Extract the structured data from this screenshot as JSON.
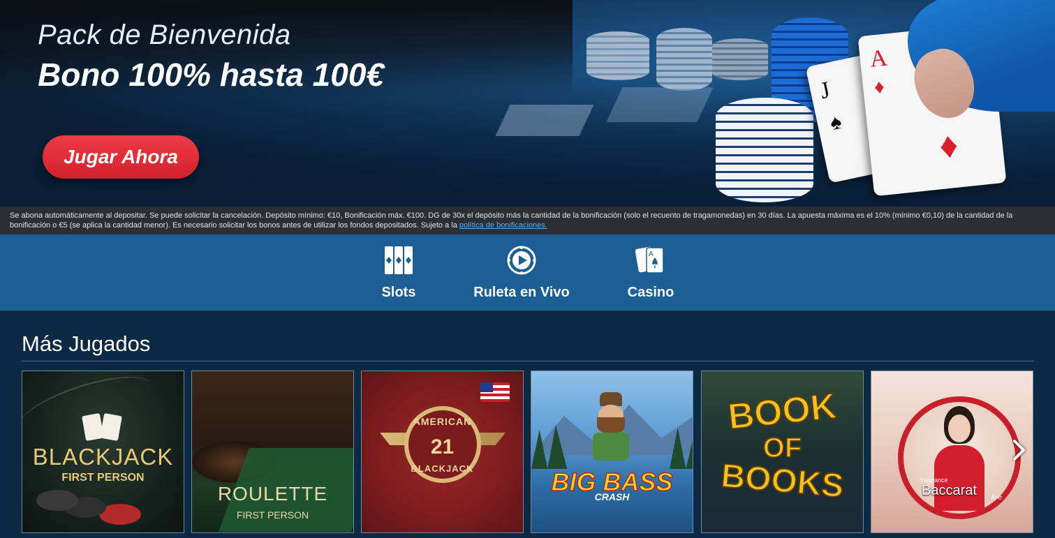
{
  "hero": {
    "subtitle": "Pack de Bienvenida",
    "title": "Bono 100% hasta 100€",
    "cta_label": "Jugar Ahora"
  },
  "disclaimer": {
    "text": "Se abona automáticamente al depositar. Se puede solicitar la cancelación. Depósito mínimo: €10, Bonificación máx. €100. DG de 30x el depósito más la cantidad de la bonificación (solo el recuento de tragamonedas) en 30 días. La apuesta máxima es el 10% (mínimo €0,10) de la cantidad de la bonificación o €5 (se aplica la cantidad menor). Es necesario solicitar los bonos antes de utilizar los fondos depositados. Sujeto a la ",
    "link_label": "política de bonificaciones."
  },
  "categories": [
    {
      "label": "Slots",
      "icon": "slots-icon"
    },
    {
      "label": "Ruleta en Vivo",
      "icon": "roulette-icon"
    },
    {
      "label": "Casino",
      "icon": "cards-icon"
    }
  ],
  "most_played": {
    "title": "Más Jugados",
    "games": [
      {
        "line1": "BLACKJACK",
        "line2": "FIRST PERSON"
      },
      {
        "line1": "ROULETTE",
        "line2": "FIRST PERSON"
      },
      {
        "line1": "AMERICAN",
        "line2": "21",
        "line3": "BLACKJACK"
      },
      {
        "line1": "BIG BASS",
        "line2": "CRASH"
      },
      {
        "line1": "BOOK",
        "line2": "OF",
        "line3": "BOOKS"
      },
      {
        "line1": "Insurance",
        "line2": "Baccarat",
        "line3": "live"
      }
    ]
  },
  "colors": {
    "cta": "#e02a35",
    "nav_bg": "#1b5f94",
    "section_bg": "#0c2a44",
    "link": "#4fb2ff"
  }
}
